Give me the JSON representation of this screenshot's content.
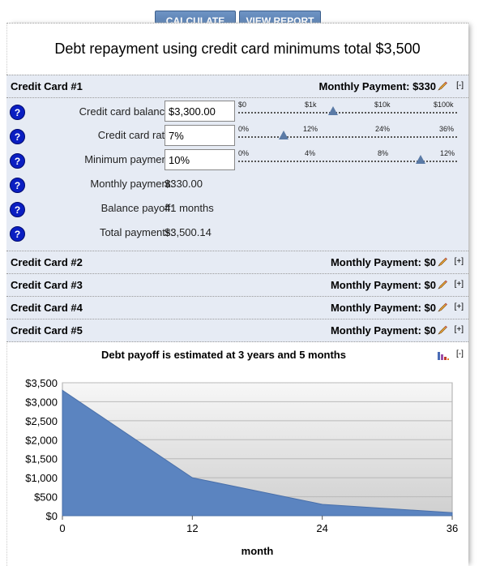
{
  "toolbar": {
    "calculate_label": "CALCULATE",
    "report_label": "VIEW REPORT"
  },
  "title": "Debt repayment using credit card minimums total $3,500",
  "card1": {
    "name": "Credit Card #1",
    "monthly_payment_header": "Monthly Payment: $330",
    "toggle": "[-]",
    "fields": {
      "balance_label": "Credit card balance:",
      "balance_value": "$3,300.00",
      "rate_label": "Credit card rate:",
      "rate_value": "7%",
      "minimum_label": "Minimum payment:",
      "minimum_value": "10%",
      "monthly_label": "Monthly payment:",
      "monthly_value": "$330.00",
      "payoff_label": "Balance payoff:",
      "payoff_value": "41 months",
      "total_label": "Total payments:",
      "total_value": "$3,500.14"
    },
    "sliders": {
      "balance": {
        "ticks": [
          "$0",
          "$1k",
          "$10k",
          "$100k"
        ],
        "position": 0.42
      },
      "rate": {
        "ticks": [
          "0%",
          "12%",
          "24%",
          "36%"
        ],
        "position": 0.19
      },
      "minimum": {
        "ticks": [
          "0%",
          "4%",
          "8%",
          "12%"
        ],
        "position": 0.83
      }
    }
  },
  "cards": [
    {
      "name": "Credit Card #2",
      "monthly_payment_header": "Monthly Payment: $0",
      "toggle": "[+]"
    },
    {
      "name": "Credit Card #3",
      "monthly_payment_header": "Monthly Payment: $0",
      "toggle": "[+]"
    },
    {
      "name": "Credit Card #4",
      "monthly_payment_header": "Monthly Payment: $0",
      "toggle": "[+]"
    },
    {
      "name": "Credit Card #5",
      "monthly_payment_header": "Monthly Payment: $0",
      "toggle": "[+]"
    }
  ],
  "help_glyph": "?",
  "chart_toggle": "[-]",
  "colors": {
    "button": "#5a7fb3",
    "area_fill": "#5b84c0",
    "panel_bg": "#e6ebf4",
    "help": "#0a1ec2"
  },
  "chart_data": {
    "type": "area",
    "title": "Debt payoff is estimated at 3 years and 5 months",
    "xlabel": "month",
    "ylabel": "",
    "x": [
      0,
      12,
      24,
      36
    ],
    "values": [
      3300,
      1000,
      300,
      80
    ],
    "xlim": [
      0,
      36
    ],
    "ylim": [
      0,
      3500
    ],
    "x_ticks": [
      "0",
      "12",
      "24",
      "36"
    ],
    "y_ticks": [
      "$0",
      "$500",
      "$1,000",
      "$1,500",
      "$2,000",
      "$2,500",
      "$3,000",
      "$3,500"
    ],
    "y_tick_values": [
      0,
      500,
      1000,
      1500,
      2000,
      2500,
      3000,
      3500
    ],
    "grid": true,
    "legend": "none"
  }
}
